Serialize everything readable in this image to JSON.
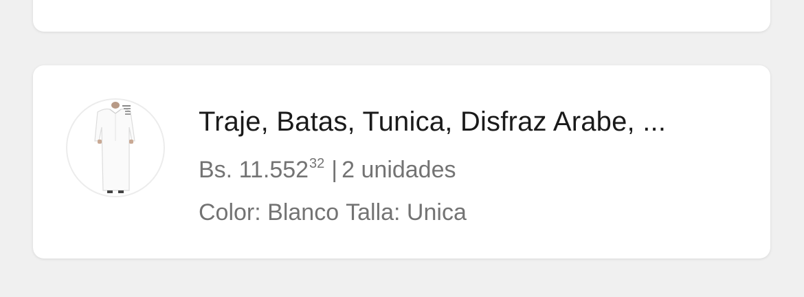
{
  "item": {
    "title": "Traje, Batas, Tunica, Disfraz Arabe, ...",
    "price": {
      "currency": "Bs.",
      "amount": "11.552",
      "cents": "32"
    },
    "separator": "|",
    "quantity_text": "2 unidades",
    "color_text": "Color: Blanco",
    "size_text": "Talla: Unica",
    "image_icon": "white-tunic-product-photo"
  }
}
